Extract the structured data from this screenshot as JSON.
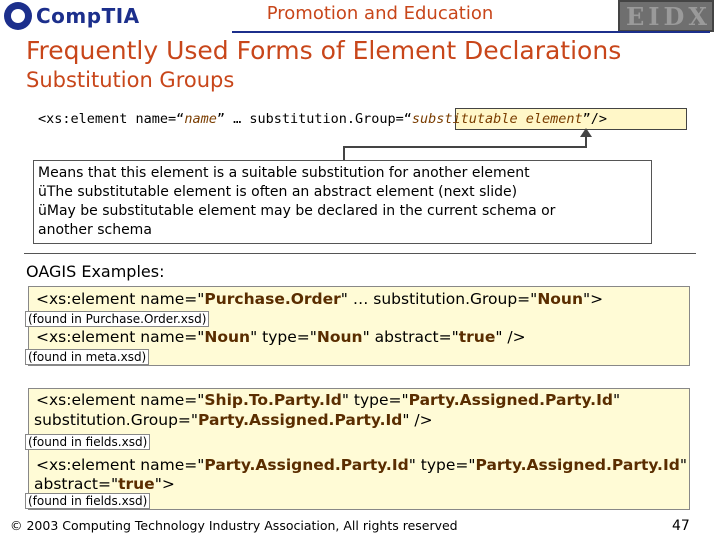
{
  "header": {
    "logo_left": "CompTIA",
    "title": "Promotion and Education",
    "logo_right": "EIDX"
  },
  "slide": {
    "title": "Frequently Used Forms of Element Declarations",
    "subtitle": "Substitution Groups",
    "code": {
      "prefix": "<xs:element name=“",
      "name": "name",
      "middle": "” … substitution.Group=“",
      "group": "substitutable element",
      "suffix": "”/>"
    },
    "explanation": [
      "Means that this element is a suitable substitution for another element",
      "üThe substitutable element is often an abstract element (next slide)",
      "üMay be substitutable element may be declared in the current schema or",
      "another schema"
    ],
    "examples_label": "OAGIS Examples:",
    "example1": {
      "line1_a": "<xs:element name=\"",
      "line1_v1": "Purchase.Order",
      "line1_b": "\" … substitution.Group=\"",
      "line1_v2": "Noun",
      "line1_c": "\">",
      "found1": "(found in Purchase.Order.xsd)",
      "line2_a": "<xs:element name=\"",
      "line2_v1": "Noun",
      "line2_b": "\" type=\"",
      "line2_v2": "Noun",
      "line2_c": "\" abstract=\"",
      "line2_v3": "true",
      "line2_d": "\" />",
      "found2": "(found in meta.xsd)"
    },
    "example2": {
      "line1_a": "<xs:element name=\"",
      "line1_v1": "Ship.To.Party.Id",
      "line1_b": "\" type=\"",
      "line1_v2": "Party.Assigned.Party.Id",
      "line1_c": "\"",
      "line2_a": "substitution.Group=\"",
      "line2_v1": "Party.Assigned.Party.Id",
      "line2_b": "\" />",
      "found1": "(found in fields.xsd)",
      "line3_a": "<xs:element name=\"",
      "line3_v1": "Party.Assigned.Party.Id",
      "line3_b": "\" type=\"",
      "line3_v2": "Party.Assigned.Party.Id",
      "line3_c": "\"",
      "line4_a": "abstract=\"",
      "line4_v1": "true",
      "line4_b": "\">",
      "found2": "(found in fields.xsd)"
    }
  },
  "footer": {
    "copyright": "© 2003 Computing Technology Industry Association, All rights reserved",
    "page_number": "47"
  }
}
